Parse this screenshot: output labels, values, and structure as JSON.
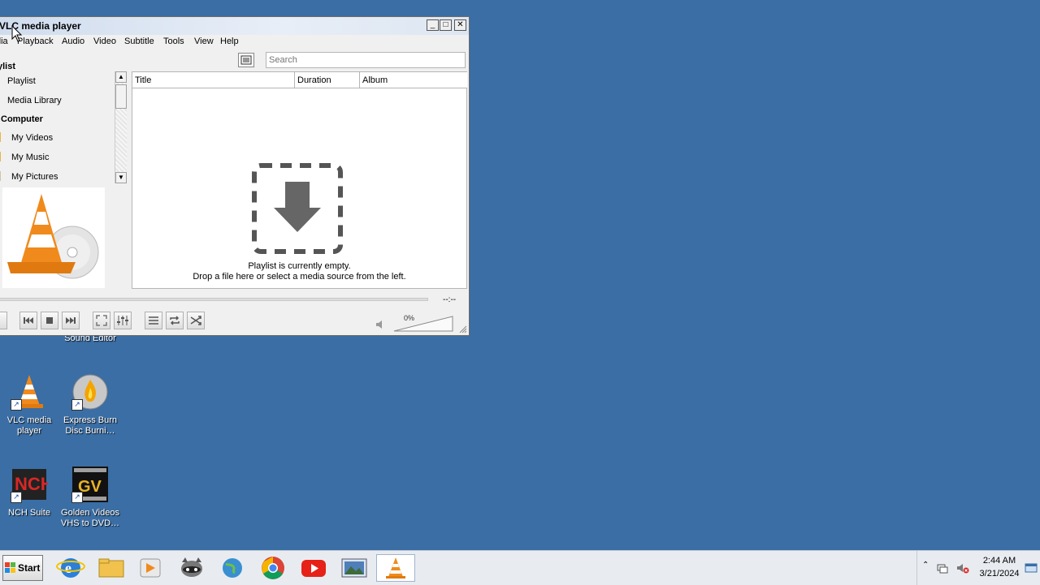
{
  "desktop": {
    "icons": [
      {
        "label": "Sound Editor"
      },
      {
        "label": "VLC media player"
      },
      {
        "label": "Express Burn Disc Burni…"
      },
      {
        "label": "NCH Suite"
      },
      {
        "label": "Golden Videos VHS to DVD…"
      }
    ]
  },
  "window": {
    "title": "VLC media player",
    "controls": {
      "minimize": "_",
      "maximize": "□",
      "close": "✕"
    },
    "menu": [
      "dia",
      "Playback",
      "Audio",
      "Video",
      "Subtitle",
      "Tools",
      "View",
      "Help"
    ],
    "search": {
      "placeholder": "Search",
      "value": ""
    },
    "sidebar": {
      "header": "ylist",
      "items": [
        {
          "label": "Playlist"
        },
        {
          "label": "Media Library"
        }
      ],
      "section": "Computer",
      "folders": [
        {
          "label": "My Videos"
        },
        {
          "label": "My Music"
        },
        {
          "label": "My Pictures"
        }
      ]
    },
    "playlist": {
      "columns": [
        "Title",
        "Duration",
        "Album"
      ],
      "empty_line1": "Playlist is currently empty.",
      "empty_line2": "Drop a file here or select a media source from the left."
    },
    "player": {
      "time": "--:--",
      "volume": "0%"
    }
  },
  "taskbar": {
    "start_label": "Start",
    "clock_time": "2:44 AM",
    "clock_date": "3/21/2024"
  },
  "colors": {
    "desktop": "#3a6ea5",
    "vlc_orange": "#f08a1c",
    "youtube_red": "#e62117"
  }
}
